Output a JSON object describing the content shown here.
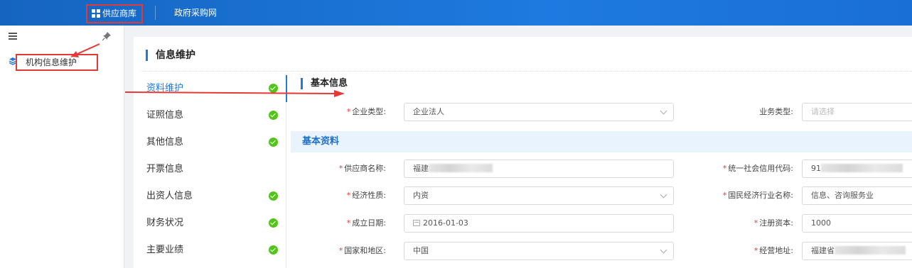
{
  "topbar": {
    "tabs": [
      {
        "label": "供应商库",
        "active": true,
        "icon": "grid-icon"
      },
      {
        "label": "政府采购网",
        "active": false
      }
    ]
  },
  "sidebar": {
    "toggle_icon": "hamburger-icon",
    "pin_icon": "pin-icon",
    "items": [
      {
        "label": "机构信息维护",
        "icon": "layers-icon",
        "selected": true
      }
    ]
  },
  "page": {
    "title": "信息维护",
    "steps": [
      {
        "label": "资料维护",
        "done": true,
        "active": true
      },
      {
        "label": "证照信息",
        "done": true,
        "active": false
      },
      {
        "label": "其他信息",
        "done": true,
        "active": false
      },
      {
        "label": "开票信息",
        "done": false,
        "active": false
      },
      {
        "label": "出资人信息",
        "done": true,
        "active": false
      },
      {
        "label": "财务状况",
        "done": true,
        "active": false
      },
      {
        "label": "主要业绩",
        "done": true,
        "active": false
      }
    ]
  },
  "form": {
    "section_title": "基本信息",
    "sub_header": "基本资料",
    "fields": {
      "enterprise_type": {
        "label": "企业类型:",
        "required": true,
        "value": "企业法人",
        "kind": "select"
      },
      "business_type": {
        "label": "业务类型:",
        "required": false,
        "placeholder": "请选择",
        "kind": "select"
      },
      "supplier_name": {
        "label": "供应商名称:",
        "required": true,
        "value": "福建",
        "kind": "input"
      },
      "credit_code": {
        "label": "统一社会信用代码:",
        "required": true,
        "value": "91",
        "kind": "input"
      },
      "economic_nature": {
        "label": "经济性质:",
        "required": true,
        "value": "内资",
        "kind": "select"
      },
      "industry_name": {
        "label": "国民经济行业名称:",
        "required": true,
        "value": "信息、咨询服务业",
        "kind": "input"
      },
      "established_date": {
        "label": "成立日期:",
        "required": true,
        "value": "2016-01-03",
        "kind": "date"
      },
      "registered_capital": {
        "label": "注册资本:",
        "required": true,
        "value": "1000",
        "kind": "input"
      },
      "country_region": {
        "label": "国家和地区:",
        "required": true,
        "value": "中国",
        "kind": "select"
      },
      "business_address": {
        "label": "经营地址:",
        "required": true,
        "value": "福建省",
        "kind": "input"
      }
    }
  },
  "colors": {
    "accent": "#1e7ae0",
    "annotation": "#e53935",
    "success": "#52c41a"
  }
}
